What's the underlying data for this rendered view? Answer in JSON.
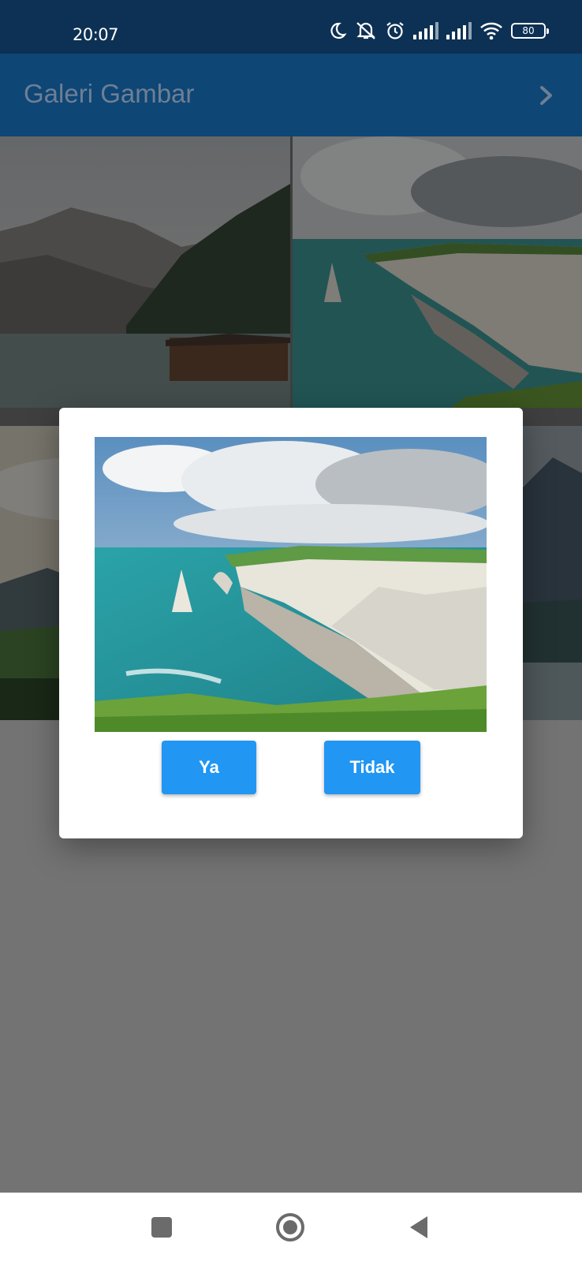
{
  "status_bar": {
    "time": "20:07",
    "battery": "80",
    "icons": [
      "moon-icon",
      "silent-icon",
      "alarm-icon",
      "signal-icon",
      "signal-icon",
      "wifi-icon",
      "battery-icon"
    ]
  },
  "app_bar": {
    "title": "Galeri Gambar",
    "action_icon": "chevron-right-icon"
  },
  "gallery": {
    "tiles": [
      "mountain-lake-photo",
      "coastal-cliffs-photo",
      "valley-photo",
      "forest-lake-photo"
    ]
  },
  "dialog": {
    "image": "coastal-cliffs-photo",
    "confirm_label": "Ya",
    "cancel_label": "Tidak"
  },
  "nav_bar": {
    "icons": [
      "recents-square-icon",
      "home-circle-icon",
      "back-triangle-icon"
    ]
  },
  "colors": {
    "status_bar": "#0d3154",
    "app_bar": "#0e4676",
    "button": "#2196f3",
    "scrim_background": "#737373"
  }
}
